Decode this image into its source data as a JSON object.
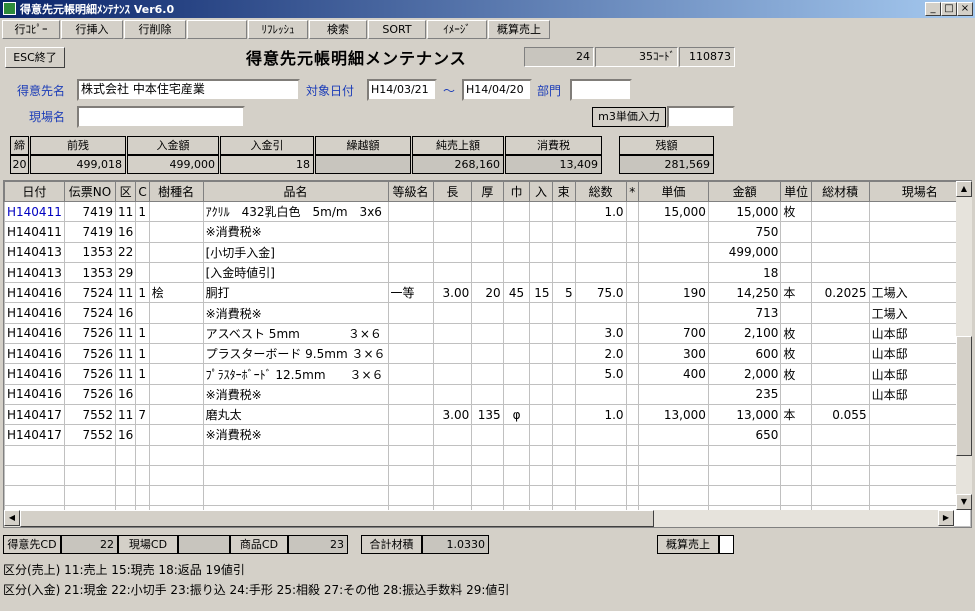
{
  "window": {
    "title": "得意先元帳明細ﾒﾝﾃﾅﾝｽ Ver6.0"
  },
  "toolbar": {
    "copy_row": "行ｺﾋﾟｰ",
    "insert_row": "行挿入",
    "delete_row": "行削除",
    "refresh": "ﾘﾌﾚｯｼｭ",
    "search": "検索",
    "sort": "SORT",
    "image": "ｲﾒｰｼﾞ",
    "rough_sales": "概算売上"
  },
  "header": {
    "esc_label": "ESC終了",
    "page_title": "得意先元帳明細メンテナンス",
    "page_current": "24",
    "page_total": "35",
    "code_label": "ｺｰﾄﾞ",
    "code_value": "110873"
  },
  "form": {
    "customer_label": "得意先名",
    "customer_value": "株式会社 中本住宅産業",
    "date_label": "対象日付",
    "date_from": "H14/03/21",
    "tilde": "～",
    "date_to": "H14/04/20",
    "dept_label": "部門",
    "dept_value": "",
    "site_label": "現場名",
    "site_value": "",
    "m3_label": "m3単価入力",
    "m3_value": ""
  },
  "summary": {
    "close_label": "締",
    "close_value": "20",
    "prev_label": "前残",
    "prev_value": "499,018",
    "deposit_label": "入金額",
    "deposit_value": "499,000",
    "discount_label": "入金引",
    "discount_value": "18",
    "carry_label": "繰越額",
    "carry_value": "",
    "net_sales_label": "純売上額",
    "net_sales_value": "268,160",
    "tax_label": "消費税",
    "tax_value": "13,409",
    "balance_label": "残額",
    "balance_value": "281,569"
  },
  "grid": {
    "columns": [
      "日付",
      "伝票NO",
      "区",
      "C",
      "樹種名",
      "品名",
      "等級名",
      "長",
      "厚",
      "巾",
      "入",
      "束",
      "総数",
      "*",
      "単価",
      "金額",
      "単位",
      "総材積",
      "現場名"
    ],
    "rows": [
      [
        "H140411",
        "7419",
        "11",
        "1",
        "",
        "ｱｸﾘﾙ　432乳白色　5m/m　3x6",
        "",
        "",
        "",
        "",
        "",
        "",
        "1.0",
        "",
        "15,000",
        "15,000",
        "枚",
        "",
        ""
      ],
      [
        "H140411",
        "7419",
        "16",
        "",
        "",
        "※消費税※",
        "",
        "",
        "",
        "",
        "",
        "",
        "",
        "",
        "",
        "750",
        "",
        "",
        ""
      ],
      [
        "H140413",
        "1353",
        "22",
        "",
        "",
        "[小切手入金]",
        "",
        "",
        "",
        "",
        "",
        "",
        "",
        "",
        "",
        "499,000",
        "",
        "",
        ""
      ],
      [
        "H140413",
        "1353",
        "29",
        "",
        "",
        "[入金時値引]",
        "",
        "",
        "",
        "",
        "",
        "",
        "",
        "",
        "",
        "18",
        "",
        "",
        ""
      ],
      [
        "H140416",
        "7524",
        "11",
        "1",
        "桧",
        "胴打",
        "一等",
        "3.00",
        "20",
        "45",
        "15",
        "5",
        "75.0",
        "",
        "190",
        "14,250",
        "本",
        "0.2025",
        "工場入"
      ],
      [
        "H140416",
        "7524",
        "16",
        "",
        "",
        "※消費税※",
        "",
        "",
        "",
        "",
        "",
        "",
        "",
        "",
        "",
        "713",
        "",
        "",
        "工場入"
      ],
      [
        "H140416",
        "7526",
        "11",
        "1",
        "",
        "アスベスト 5mm　　　　３×６",
        "",
        "",
        "",
        "",
        "",
        "",
        "3.0",
        "",
        "700",
        "2,100",
        "枚",
        "",
        "山本邸"
      ],
      [
        "H140416",
        "7526",
        "11",
        "1",
        "",
        "プラスターボード 9.5mm ３×６",
        "",
        "",
        "",
        "",
        "",
        "",
        "2.0",
        "",
        "300",
        "600",
        "枚",
        "",
        "山本邸"
      ],
      [
        "H140416",
        "7526",
        "11",
        "1",
        "",
        "ﾌﾟﾗｽﾀｰﾎﾞｰﾄﾞ 12.5mm　　３×６",
        "",
        "",
        "",
        "",
        "",
        "",
        "5.0",
        "",
        "400",
        "2,000",
        "枚",
        "",
        "山本邸"
      ],
      [
        "H140416",
        "7526",
        "16",
        "",
        "",
        "※消費税※",
        "",
        "",
        "",
        "",
        "",
        "",
        "",
        "",
        "",
        "235",
        "",
        "",
        "山本邸"
      ],
      [
        "H140417",
        "7552",
        "11",
        "7",
        "",
        "磨丸太",
        "",
        "3.00",
        "135",
        "φ",
        "",
        "",
        "1.0",
        "",
        "13,000",
        "13,000",
        "本",
        "0.055",
        ""
      ],
      [
        "H140417",
        "7552",
        "16",
        "",
        "",
        "※消費税※",
        "",
        "",
        "",
        "",
        "",
        "",
        "",
        "",
        "",
        "650",
        "",
        "",
        ""
      ]
    ],
    "empty_rows": 6
  },
  "footer": {
    "cust_cd_label": "得意先CD",
    "cust_cd_value": "22",
    "site_cd_label": "現場CD",
    "site_cd_value": "",
    "item_cd_label": "商品CD",
    "item_cd_value": "23",
    "total_vol_label": "合計材積",
    "total_vol_value": "1.0330",
    "rough_sales_label": "概算売上",
    "note_sales": "区分(売上) 11:売上 15:現売 18:返品 19値引",
    "note_deposit": "区分(入金) 21:現金 22:小切手 23:振り込 24:手形 25:相殺 27:その他 28:振込手数料 29:値引"
  }
}
